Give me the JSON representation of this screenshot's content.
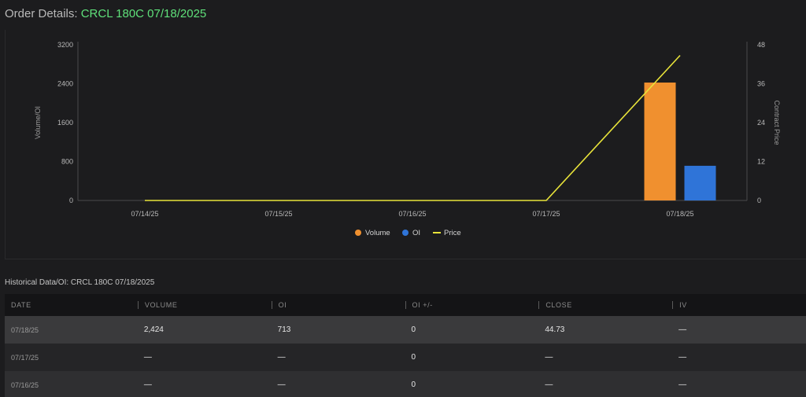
{
  "header": {
    "prefix": "Order Details: ",
    "symbol": "CRCL 180C 07/18/2025"
  },
  "colors": {
    "volume": "#f0902f",
    "oi": "#2f74d8",
    "price": "#e8e33a",
    "symbol_green": "#5fe07a"
  },
  "chart_data": {
    "type": "bar",
    "categories": [
      "07/14/25",
      "07/15/25",
      "07/16/25",
      "07/17/25",
      "07/18/25"
    ],
    "series": [
      {
        "name": "Volume",
        "type": "bar",
        "axis": "left",
        "values": [
          0,
          0,
          0,
          0,
          2424
        ]
      },
      {
        "name": "OI",
        "type": "bar",
        "axis": "left",
        "values": [
          0,
          0,
          0,
          0,
          713
        ]
      },
      {
        "name": "Price",
        "type": "line",
        "axis": "right",
        "values": [
          0,
          0,
          0,
          0,
          44.73
        ]
      }
    ],
    "y_left": {
      "label": "Volume/OI",
      "ticks": [
        "3200",
        "2400",
        "1600",
        "800",
        "0"
      ],
      "ylim": [
        0,
        3200
      ]
    },
    "y_right": {
      "label": "Contract Price",
      "ticks": [
        "48",
        "36",
        "24",
        "12",
        "0"
      ],
      "ylim": [
        0,
        48
      ]
    },
    "legend": {
      "placement": "bottom",
      "items": [
        "Volume",
        "OI",
        "Price"
      ]
    }
  },
  "history": {
    "title": "Historical Data/OI: CRCL 180C 07/18/2025",
    "columns": [
      "DATE",
      "VOLUME",
      "OI",
      "OI +/-",
      "CLOSE",
      "IV"
    ],
    "rows": [
      [
        "07/18/25",
        "2,424",
        "713",
        "0",
        "44.73",
        "—"
      ],
      [
        "07/17/25",
        "—",
        "—",
        "0",
        "—",
        "—"
      ],
      [
        "07/16/25",
        "—",
        "—",
        "0",
        "—",
        "—"
      ]
    ]
  }
}
